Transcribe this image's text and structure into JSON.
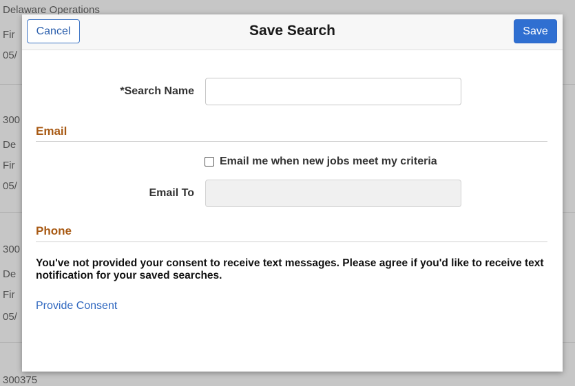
{
  "background": {
    "lines": [
      "Delaware Operations",
      "Fir",
      "05/",
      "300",
      "De",
      "Fir",
      "05/",
      "300",
      "De",
      "Fir",
      "05/",
      "300375"
    ]
  },
  "dialog": {
    "title": "Save Search",
    "cancel_label": "Cancel",
    "save_label": "Save"
  },
  "form": {
    "search_name": {
      "label": "*Search Name",
      "value": ""
    },
    "email_section": {
      "title": "Email",
      "checkbox_label": "Email me when new jobs meet my criteria",
      "checkbox_checked": false,
      "email_to_label": "Email To",
      "email_to_value": ""
    },
    "phone_section": {
      "title": "Phone",
      "consent_message": "You've not provided your consent to receive text messages. Please agree if you'd like to receive text notification for your saved searches.",
      "consent_link": "Provide Consent"
    }
  },
  "colors": {
    "accent_blue": "#2f6fd1",
    "section_title": "#a85a14",
    "link": "#2f67bf"
  }
}
